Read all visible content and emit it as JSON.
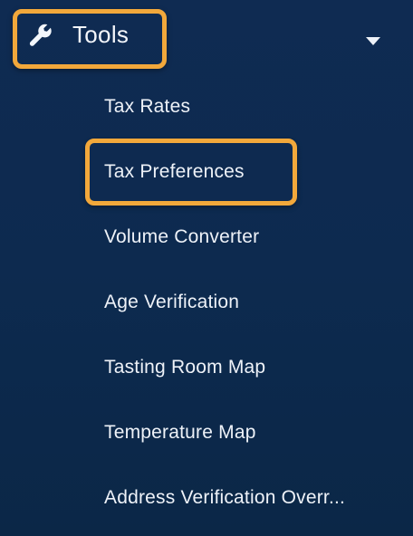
{
  "accent_color": "#f2a83b",
  "background_color": "#0f2b52",
  "section": {
    "label": "Tools",
    "icon": "wrench-icon",
    "expand_icon": "caret-down-icon",
    "expanded": true
  },
  "menu": {
    "items": [
      {
        "label": "Tax Rates",
        "active": false
      },
      {
        "label": "Tax Preferences",
        "active": true
      },
      {
        "label": "Volume Converter",
        "active": false
      },
      {
        "label": "Age Verification",
        "active": false
      },
      {
        "label": "Tasting Room Map",
        "active": false
      },
      {
        "label": "Temperature Map",
        "active": false
      },
      {
        "label": "Address Verification Overr...",
        "active": false
      }
    ]
  }
}
